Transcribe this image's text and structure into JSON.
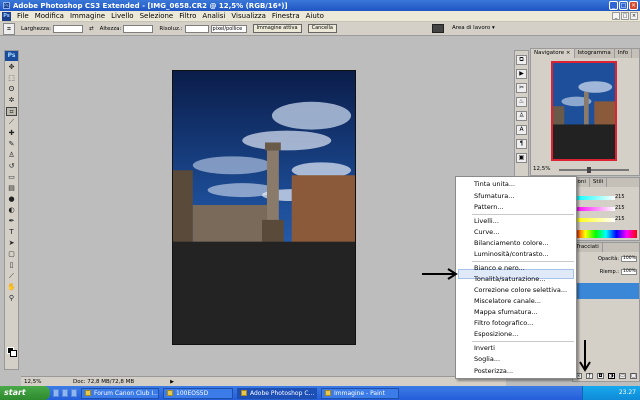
{
  "window": {
    "title": "Adobe Photoshop CS3 Extended - [IMG_0658.CR2 @ 12,5% (RGB/16*)]"
  },
  "menubar": {
    "items": [
      "File",
      "Modifica",
      "Immagine",
      "Livello",
      "Selezione",
      "Filtro",
      "Analisi",
      "Visualizza",
      "Finestra",
      "Aiuto"
    ]
  },
  "options_bar": {
    "width_label": "Larghezza:",
    "height_label": "Altezza:",
    "resolution_label": "Risoluz.:",
    "resolution_unit": "pixel/pollice",
    "front_image_button": "Immagine attiva",
    "cancel_button": "Cancella",
    "workspace_label": "Area di lavoro ▾"
  },
  "toolbox": {
    "logo": "Ps"
  },
  "status": {
    "zoom": "12,5%",
    "doc": "Doc: 72,8 MB/72,8 MB"
  },
  "navigator": {
    "tabs": [
      "Navigatore ×",
      "Istogramma",
      "Info"
    ],
    "zoom": "12,5%"
  },
  "color_panel": {
    "tabs": [
      "ioni",
      "Stili"
    ],
    "values": [
      "215",
      "215",
      "215"
    ]
  },
  "layers_panel": {
    "tabs": [
      "Tracciati"
    ],
    "opacity_label": "Opacità:",
    "opacity_value": "100%",
    "fill_label": "Riemp.:",
    "fill_value": "100%"
  },
  "context_menu": {
    "items": [
      "Tinta unita...",
      "Sfumatura...",
      "Pattern...",
      "Livelli...",
      "Curve...",
      "Bilanciamento colore...",
      "Luminosità/contrasto...",
      "Bianco e nero...",
      "Tonalità/saturazione...",
      "Correzione colore selettiva...",
      "Miscelatore canale...",
      "Mappa sfumatura...",
      "Filtro fotografico...",
      "Esposizione...",
      "Inverti",
      "Soglia...",
      "Posterizza..."
    ],
    "highlighted": "Miscelatore canale..."
  },
  "taskbar": {
    "start": "start",
    "tasks": [
      "Forum Canon Club I...",
      "100EOS5D",
      "Adobe Photoshop C...",
      "Immagine - Paint"
    ],
    "clock": "23.27"
  },
  "colors": {
    "title_blue": "#1f55c4",
    "highlight": "#dfe9f7",
    "layer_selected": "#3a87d8"
  }
}
